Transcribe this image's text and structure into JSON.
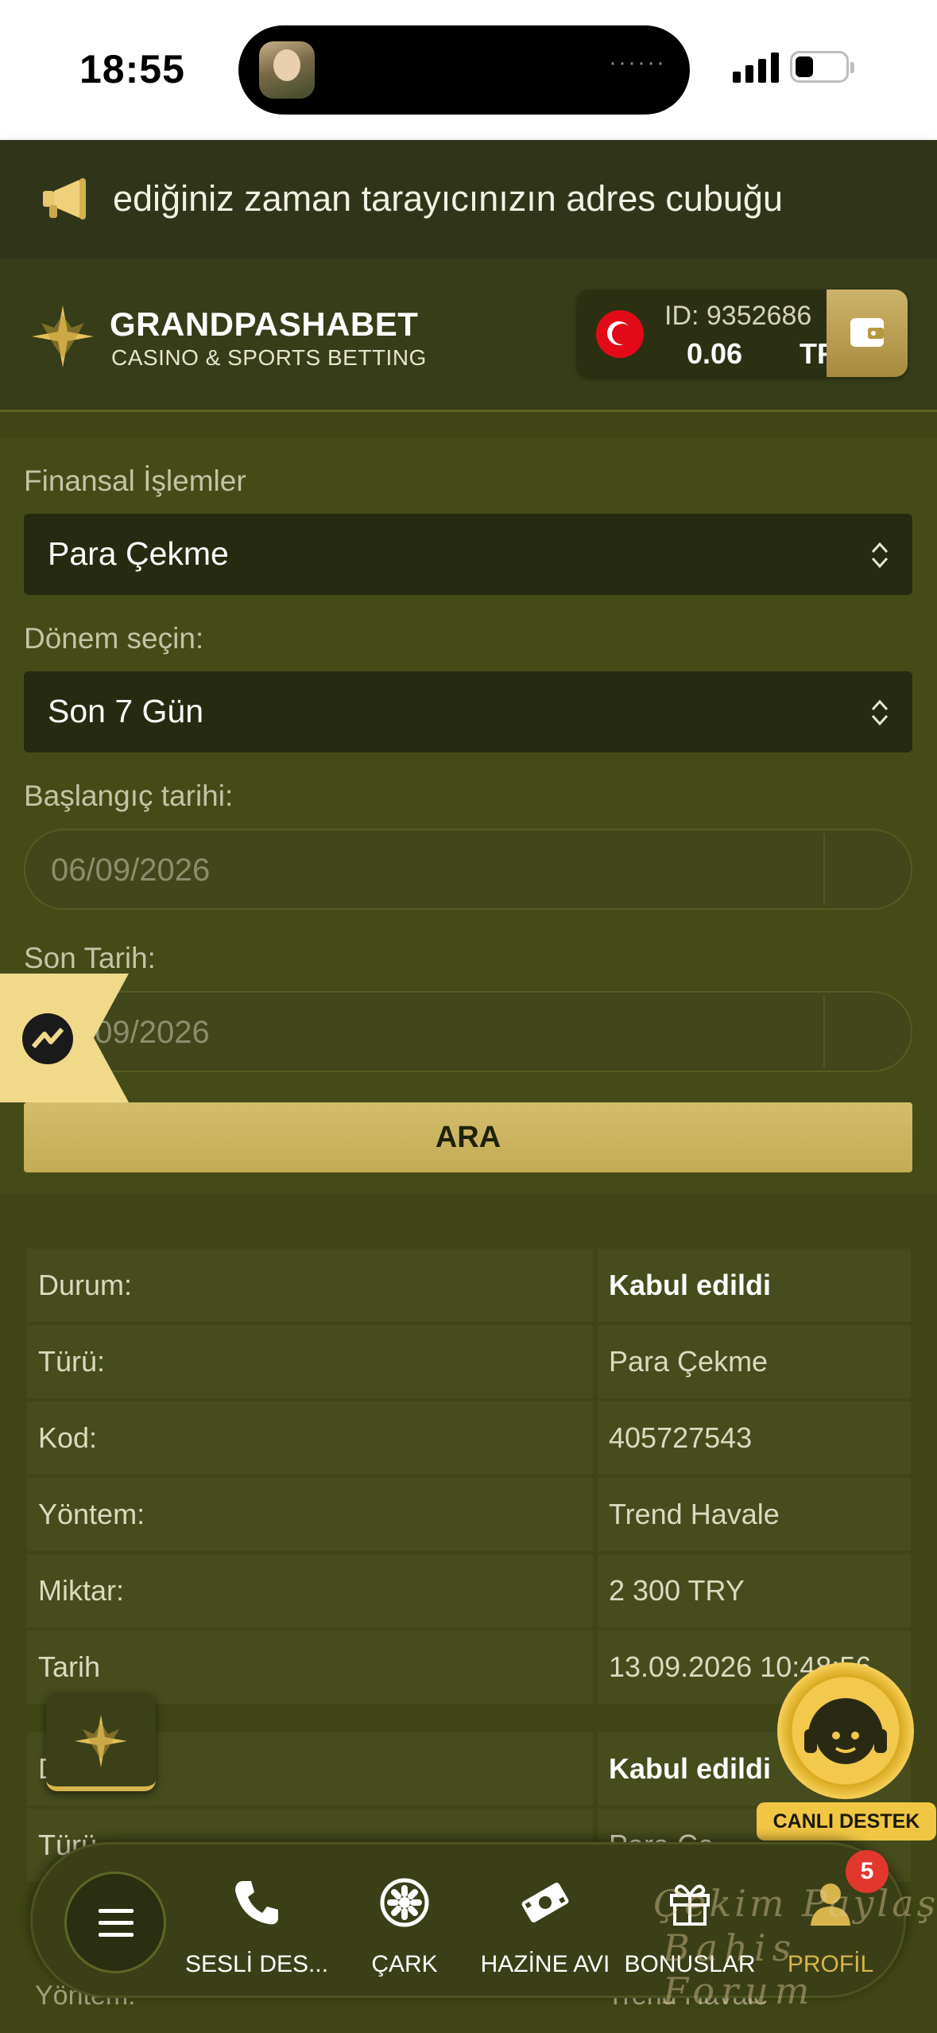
{
  "status_bar": {
    "time": "18:55",
    "icons": [
      "cellular-signal-icon",
      "battery-icon"
    ]
  },
  "announcement": {
    "icon": "megaphone-icon",
    "text": "ediğiniz zaman tarayıcınızın adres cubuğu"
  },
  "header": {
    "brand_name": "GRANDPASHABET",
    "brand_tagline": "CASINO & SPORTS BETTING",
    "account_id": "ID: 9352686",
    "balance": "0.06",
    "currency": "TRY",
    "flag": "turkey-flag-icon"
  },
  "form": {
    "financial_label": "Finansal İşlemler",
    "financial_value": "Para Çekme",
    "period_label": "Dönem seçin:",
    "period_value": "Son 7 Gün",
    "start_label": "Başlangıç tarihi:",
    "start_value": "06/09/2026",
    "end_label": "Son Tarih:",
    "end_value": "/09/2026",
    "search_label": "ARA"
  },
  "transactions": [
    {
      "rows": [
        {
          "label": "Durum:",
          "value": "Kabul edildi",
          "bold": true
        },
        {
          "label": "Türü:",
          "value": "Para Çekme"
        },
        {
          "label": "Kod:",
          "value": "405727543"
        },
        {
          "label": "Yöntem:",
          "value": "Trend Havale"
        },
        {
          "label": "Miktar:",
          "value": "2 300 TRY"
        },
        {
          "label": "Tarih",
          "value": "13.09.2026 10:48:56"
        }
      ]
    },
    {
      "rows": [
        {
          "label": "D",
          "value": "Kabul edildi",
          "bold": true
        },
        {
          "label": "Türü",
          "value": "Para Çe"
        }
      ]
    }
  ],
  "partially_hidden": {
    "label": "Yöntem:",
    "value": "Trend Havale"
  },
  "live_support": {
    "label": "CANLI DESTEK"
  },
  "bottom_nav": {
    "items": [
      {
        "label": "SESLİ DES...",
        "icon": "phone-icon"
      },
      {
        "label": "ÇARK",
        "icon": "wheel-icon"
      },
      {
        "label": "HAZİNE AVI",
        "icon": "money-icon"
      },
      {
        "label": "BONUSLAR",
        "icon": "gift-icon"
      },
      {
        "label": "PROFİL",
        "icon": "profile-icon",
        "active": true
      }
    ],
    "badge": "5"
  },
  "watermark": {
    "line1": "Çekim Paylaş",
    "line2": "Bahis Forum"
  },
  "colors": {
    "background": "#3f4514",
    "accent_gold": "#d7b54c",
    "badge_red": "#e2372d"
  }
}
